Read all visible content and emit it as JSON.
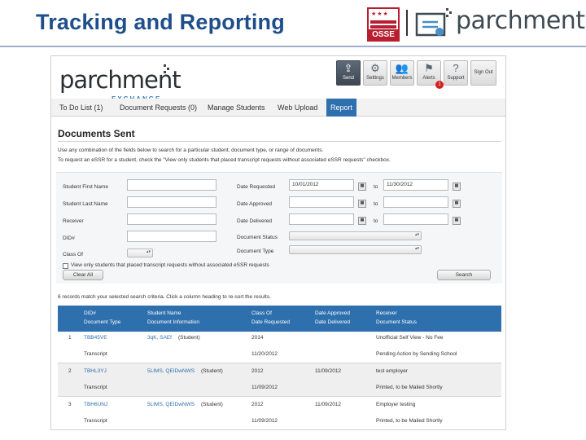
{
  "slide": {
    "title": "Tracking and Reporting"
  },
  "logos": {
    "osse": "OSSE",
    "parchment": "parchment"
  },
  "app": {
    "brand": "parchment",
    "brand_sub": "EXCHANGE",
    "toolbar": [
      {
        "label": "Send",
        "icon": "send-icon"
      },
      {
        "label": "Settings",
        "icon": "gear-icon"
      },
      {
        "label": "Members",
        "icon": "members-icon"
      },
      {
        "label": "Alerts",
        "icon": "flag-icon",
        "badge": "1"
      },
      {
        "label": "Support",
        "icon": "help-icon"
      }
    ],
    "signout": "Sign Out",
    "nav": [
      {
        "label": "To Do List (1)",
        "active": false
      },
      {
        "label": "Document Requests (0)",
        "active": false
      },
      {
        "label": "Manage Students",
        "active": false
      },
      {
        "label": "Web Upload",
        "active": false
      },
      {
        "label": "Report",
        "active": true
      }
    ],
    "heading": "Documents Sent",
    "instructions": [
      "Use any combination of the fields below to search for a particular student, document type, or range of documents.",
      "To request an eSSR for a student, check the \"View only students that placed transcript requests without associated eSSR requests\" checkbox."
    ],
    "form": {
      "student_first_name": {
        "label": "Student First Name",
        "value": ""
      },
      "student_last_name": {
        "label": "Student Last Name",
        "value": ""
      },
      "receiver": {
        "label": "Receiver",
        "value": ""
      },
      "did": {
        "label": "DID#",
        "value": ""
      },
      "class_of": {
        "label": "Class Of",
        "value": ""
      },
      "date_requested": {
        "label": "Date Requested",
        "from": "10/01/2012",
        "to": "11/30/2012"
      },
      "date_approved": {
        "label": "Date Approved",
        "from": "",
        "to": ""
      },
      "date_delivered": {
        "label": "Date Delivered",
        "from": "",
        "to": ""
      },
      "document_status": {
        "label": "Document Status",
        "value": ""
      },
      "document_type": {
        "label": "Document Type",
        "value": ""
      },
      "to_label": "to",
      "checkbox_label": "View only students that placed transcript requests without associated eSSR requests",
      "clear_label": "Clear All",
      "search_label": "Search"
    },
    "results_text": "6 records match your selected search criteria. Click a column heading to re-sort the results.",
    "columns": {
      "col1_top": "DID#",
      "col1_bottom": "Document Type",
      "col2_top": "Student Name",
      "col2_bottom": "Document Information",
      "col3_top": "Class Of",
      "col3_bottom": "Date Requested",
      "col4_top": "Date Approved",
      "col4_bottom": "Date Delivered",
      "col5_top": "Receiver",
      "col5_bottom": "Document Status"
    },
    "rows": [
      {
        "num": "1",
        "did": "TBB45VE",
        "student": "3qK, SAEf",
        "student_tag": "(Student)",
        "class_of": "2014",
        "approved": "",
        "receiver": "Unofficial Self View - No Fee",
        "doc_type": "Transcript",
        "requested": "11/20/2012",
        "delivered": "",
        "status": "Pending Action by Sending School"
      },
      {
        "num": "2",
        "did": "TBHL3YJ",
        "student": "5LIMS, QEIDwNWS",
        "student_tag": "(Student)",
        "class_of": "2012",
        "approved": "11/09/2012",
        "receiver": "test employer",
        "doc_type": "Transcript",
        "requested": "11/09/2012",
        "delivered": "",
        "status": "Printed, to be Mailed Shortly"
      },
      {
        "num": "3",
        "did": "TBH6UNJ",
        "student": "5LIMS, QEIDwNWS",
        "student_tag": "(Student)",
        "class_of": "2012",
        "approved": "11/09/2012",
        "receiver": "Employer testing",
        "doc_type": "Transcript",
        "requested": "11/09/2012",
        "delivered": "",
        "status": "Printed, to be Mailed Shortly"
      }
    ]
  },
  "colors": {
    "title": "#1f4e8c",
    "accent": "#2e6fad",
    "osse_red": "#b81e2f",
    "alert_red": "#d12020"
  }
}
